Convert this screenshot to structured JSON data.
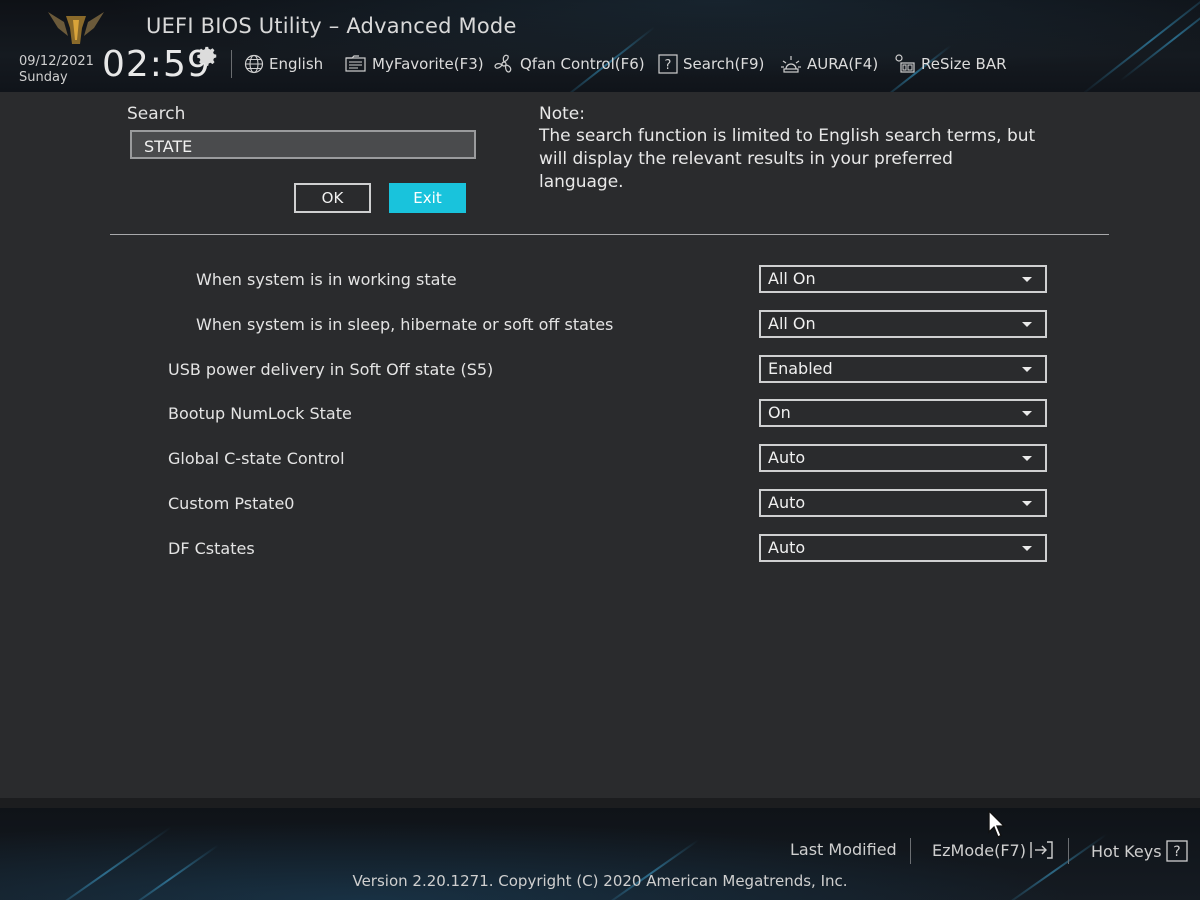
{
  "header": {
    "title": "UEFI BIOS Utility – Advanced Mode",
    "date": "09/12/2021",
    "day": "Sunday",
    "time": "02:59",
    "toolbar": {
      "language": "English",
      "my_favorite": "MyFavorite(F3)",
      "qfan": "Qfan Control(F6)",
      "search": "Search(F9)",
      "aura": "AURA(F4)",
      "resize_bar": "ReSize BAR"
    }
  },
  "search_panel": {
    "label": "Search",
    "value": "STATE",
    "ok_label": "OK",
    "exit_label": "Exit",
    "note_title": "Note:",
    "note_text": "The search function is limited to English search terms, but will display the relevant results in your preferred language."
  },
  "settings": [
    {
      "label": "When system is in working state",
      "value": "All On",
      "indent": true
    },
    {
      "label": "When system is in sleep, hibernate or soft off states",
      "value": "All On",
      "indent": true
    },
    {
      "label": "USB power delivery in Soft Off state (S5)",
      "value": "Enabled",
      "indent": false
    },
    {
      "label": "Bootup NumLock State",
      "value": "On",
      "indent": false
    },
    {
      "label": "Global C-state Control",
      "value": "Auto",
      "indent": false
    },
    {
      "label": "Custom Pstate0",
      "value": "Auto",
      "indent": false
    },
    {
      "label": "DF Cstates",
      "value": "Auto",
      "indent": false
    }
  ],
  "footer": {
    "last_modified": "Last Modified",
    "ezmode": "EzMode(F7)",
    "hot_keys": "Hot Keys",
    "version": "Version 2.20.1271. Copyright (C) 2020 American Megatrends, Inc."
  },
  "colors": {
    "accent": "#19c3dc",
    "background": "#2a2b2d",
    "header_bg": "#11151b"
  }
}
